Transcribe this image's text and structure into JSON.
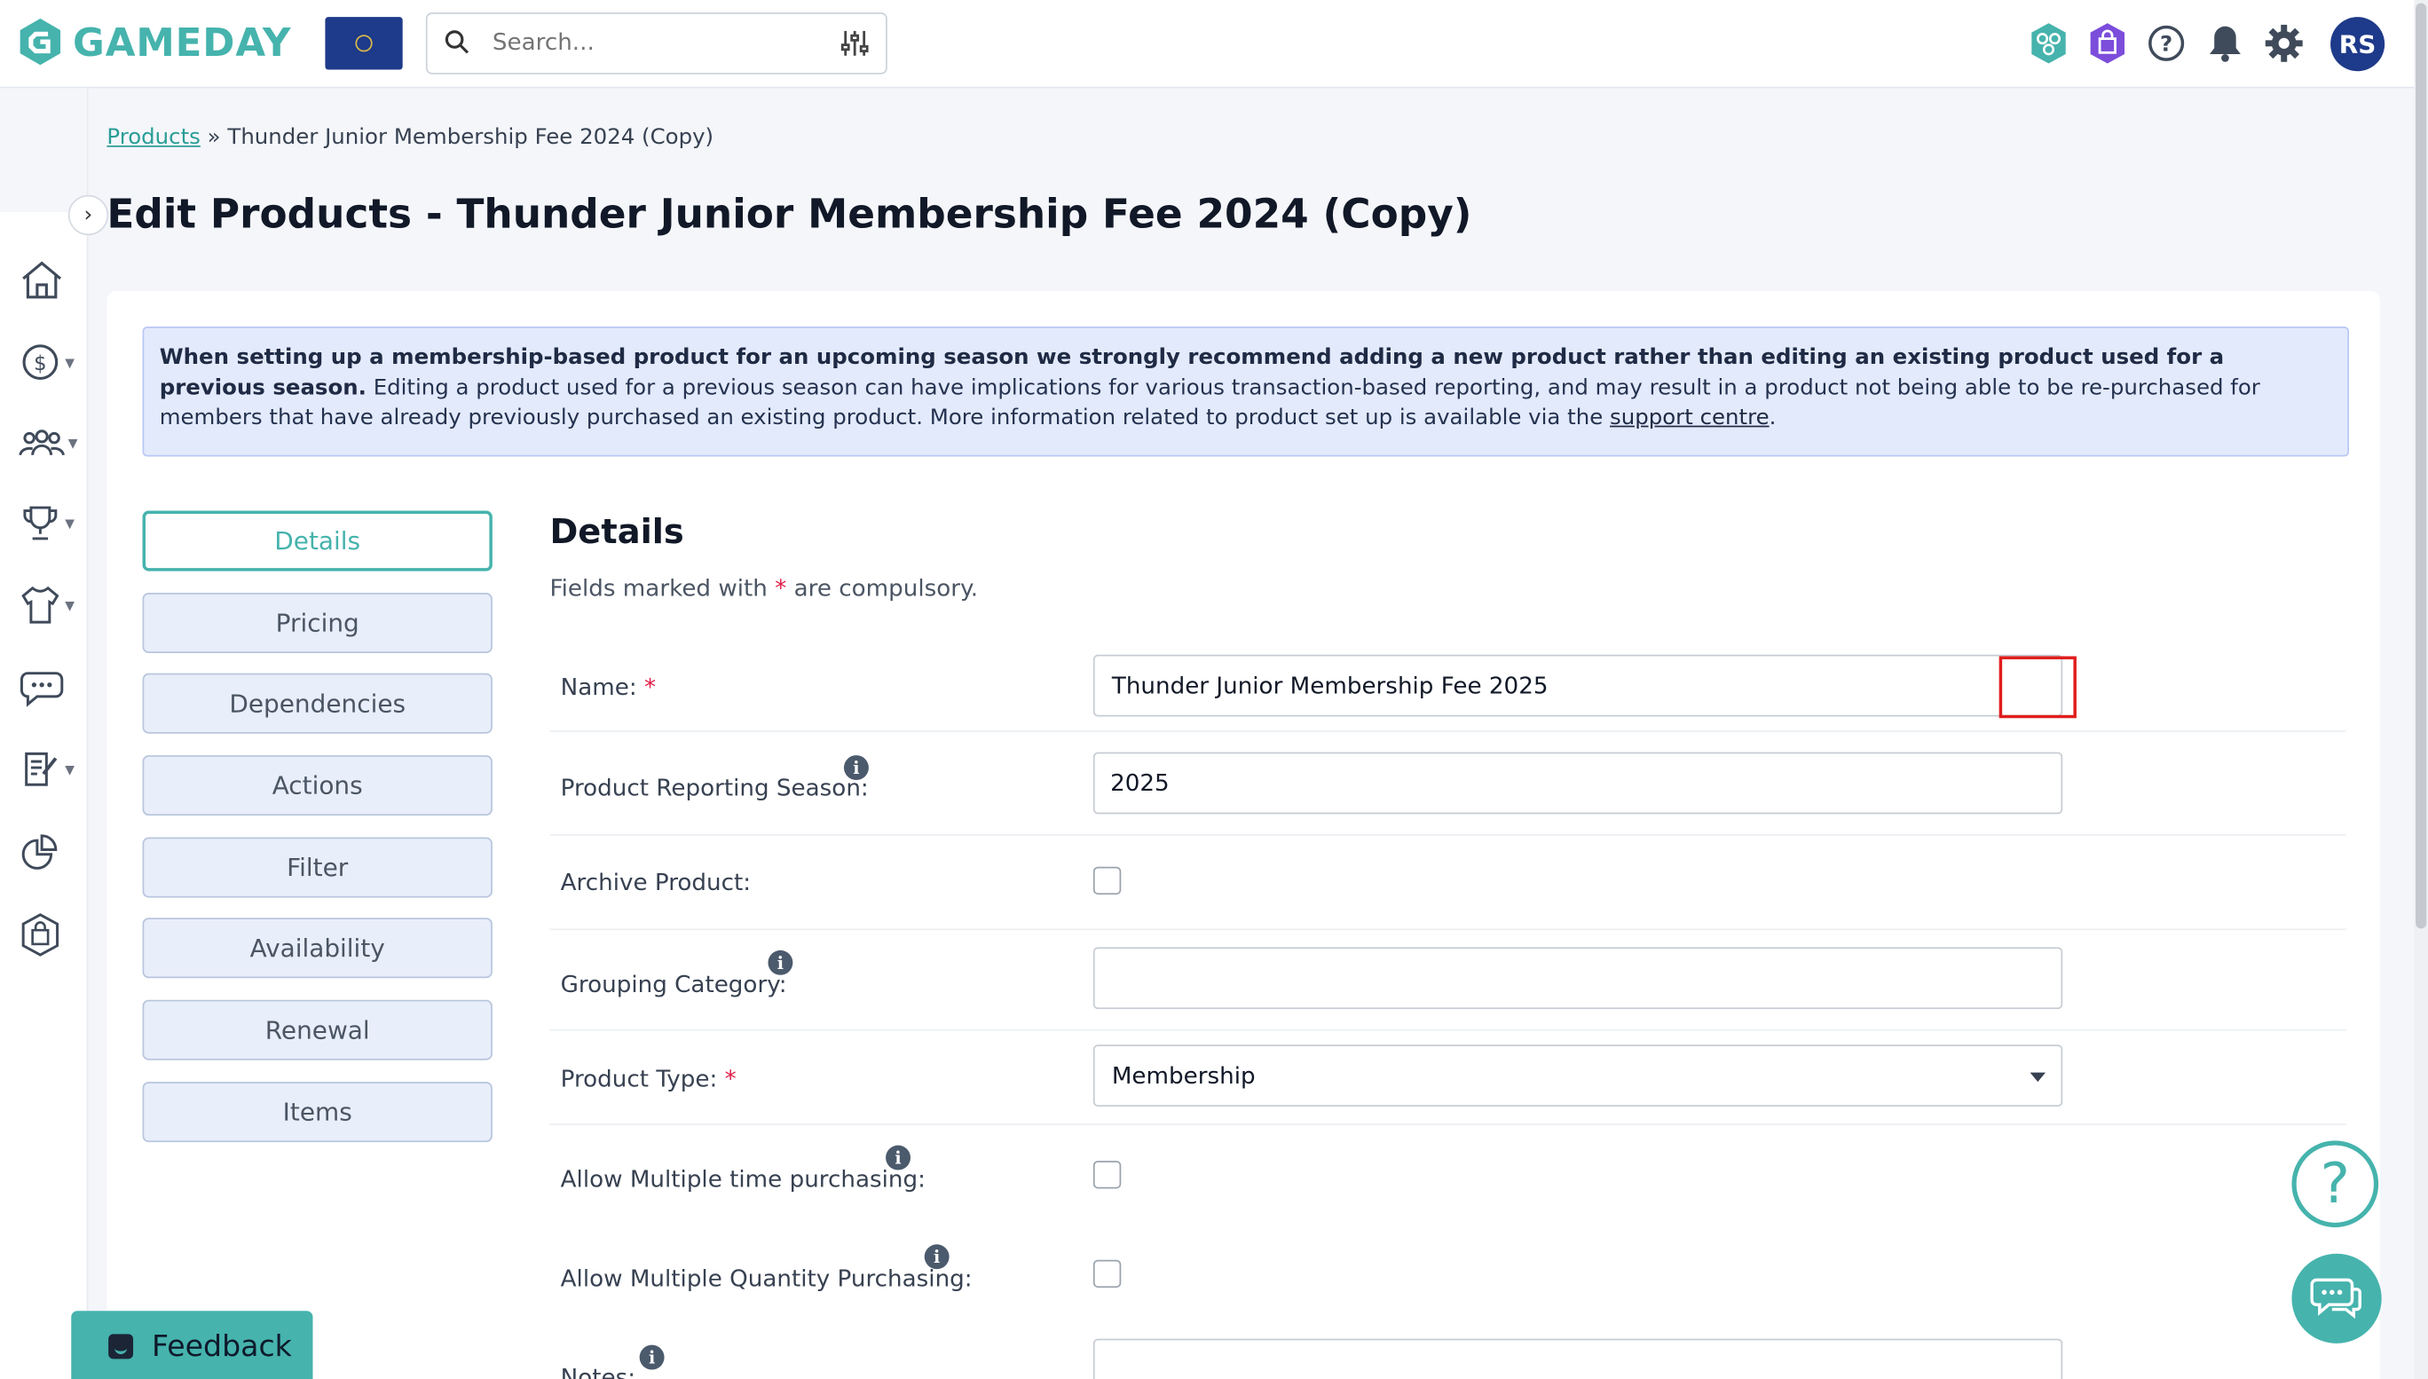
{
  "app": {
    "logo_text": "GAMEDAY"
  },
  "search": {
    "placeholder": "Search..."
  },
  "header": {
    "avatar_initials": "RS"
  },
  "breadcrumb": {
    "link": "Products",
    "separator": "»",
    "current": "Thunder Junior Membership Fee 2024 (Copy)"
  },
  "page": {
    "title": "Edit Products - Thunder Junior Membership Fee 2024 (Copy)"
  },
  "notice": {
    "bold": "When setting up a membership-based product for an upcoming season we strongly recommend adding a new product rather than editing an existing product used for a previous season.",
    "text": " Editing a product used for a previous season can have implications for various transaction-based reporting, and may result in a product not being able to be re-purchased for members that have already previously purchased an existing product. More information related to product set up is available via the ",
    "link": "support centre",
    "end": "."
  },
  "tabs": [
    "Details",
    "Pricing",
    "Dependencies",
    "Actions",
    "Filter",
    "Availability",
    "Renewal",
    "Items"
  ],
  "details": {
    "title": "Details",
    "sub_before": "Fields marked with ",
    "sub_star": "*",
    "sub_after": " are compulsory.",
    "name_label": "Name:",
    "name_value": "Thunder Junior Membership Fee 2025",
    "season_label": "Product Reporting Season:",
    "season_value": "2025",
    "archive_label": "Archive Product:",
    "grouping_label": "Grouping Category:",
    "grouping_value": "",
    "type_label": "Product Type:",
    "type_value": "Membership",
    "multi_time_label": "Allow Multiple time purchasing:",
    "multi_qty_label": "Allow Multiple Quantity Purchasing:",
    "notes_label": "Notes:",
    "info_glyph": "i",
    "req_star": "*"
  },
  "widgets": {
    "help_glyph": "?",
    "feedback_label": "Feedback"
  },
  "colors": {
    "accent": "#46b3ad",
    "navy": "#1e3a8a",
    "required": "#e11d48",
    "highlight": "#e11d1d"
  }
}
